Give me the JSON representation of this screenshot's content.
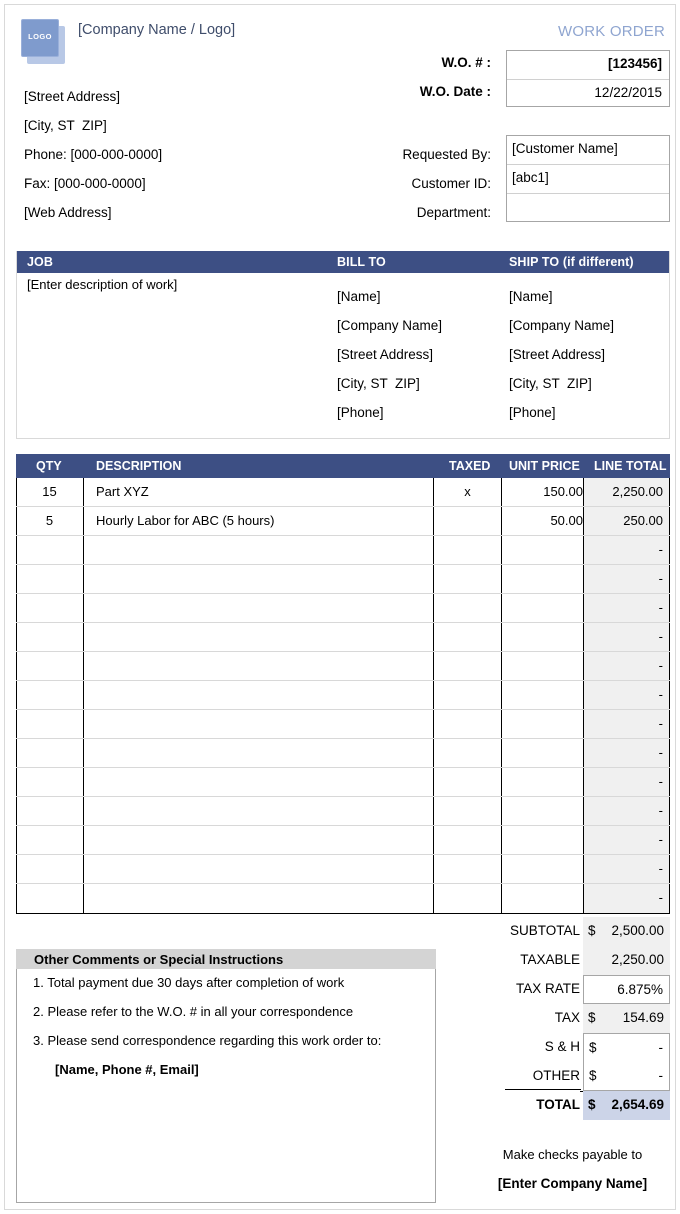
{
  "document": {
    "title": "WORK ORDER",
    "accent_color": "#3d4f84",
    "title_color": "#8fa5d0"
  },
  "company": {
    "logo_text": "LOGO",
    "name_placeholder": "[Company Name / Logo]",
    "address_lines": [
      "[Street Address]",
      "[City, ST  ZIP]",
      "Phone: [000-000-0000]",
      "Fax: [000-000-0000]",
      "[Web Address]"
    ]
  },
  "order_info": {
    "wo_number_label": "W.O. # :",
    "wo_number_value": "[123456]",
    "wo_date_label": "W.O. Date :",
    "wo_date_value": "12/22/2015",
    "requested_by_label": "Requested By:",
    "requested_by_value": "[Customer Name]",
    "customer_id_label": "Customer ID:",
    "customer_id_value": "[abc1]",
    "department_label": "Department:",
    "department_value": ""
  },
  "job_section": {
    "job_header": "JOB",
    "bill_to_header": "BILL TO",
    "ship_to_header": "SHIP TO (if different)",
    "job_description": "[Enter description of work]",
    "bill_to_lines": [
      "[Name]",
      "[Company Name]",
      "[Street Address]",
      "[City, ST  ZIP]",
      "[Phone]"
    ],
    "ship_to_lines": [
      "[Name]",
      "[Company Name]",
      "[Street Address]",
      "[City, ST  ZIP]",
      "[Phone]"
    ]
  },
  "line_items": {
    "columns": [
      "QTY",
      "DESCRIPTION",
      "TAXED",
      "UNIT PRICE",
      "LINE TOTAL"
    ],
    "rows": [
      {
        "qty": "15",
        "description": "Part XYZ",
        "taxed": "x",
        "unit_price": "150.00",
        "line_total": "2,250.00"
      },
      {
        "qty": "5",
        "description": "Hourly Labor for ABC (5 hours)",
        "taxed": "",
        "unit_price": "50.00",
        "line_total": "250.00"
      },
      {
        "qty": "",
        "description": "",
        "taxed": "",
        "unit_price": "",
        "line_total": "-"
      },
      {
        "qty": "",
        "description": "",
        "taxed": "",
        "unit_price": "",
        "line_total": "-"
      },
      {
        "qty": "",
        "description": "",
        "taxed": "",
        "unit_price": "",
        "line_total": "-"
      },
      {
        "qty": "",
        "description": "",
        "taxed": "",
        "unit_price": "",
        "line_total": "-"
      },
      {
        "qty": "",
        "description": "",
        "taxed": "",
        "unit_price": "",
        "line_total": "-"
      },
      {
        "qty": "",
        "description": "",
        "taxed": "",
        "unit_price": "",
        "line_total": "-"
      },
      {
        "qty": "",
        "description": "",
        "taxed": "",
        "unit_price": "",
        "line_total": "-"
      },
      {
        "qty": "",
        "description": "",
        "taxed": "",
        "unit_price": "",
        "line_total": "-"
      },
      {
        "qty": "",
        "description": "",
        "taxed": "",
        "unit_price": "",
        "line_total": "-"
      },
      {
        "qty": "",
        "description": "",
        "taxed": "",
        "unit_price": "",
        "line_total": "-"
      },
      {
        "qty": "",
        "description": "",
        "taxed": "",
        "unit_price": "",
        "line_total": "-"
      },
      {
        "qty": "",
        "description": "",
        "taxed": "",
        "unit_price": "",
        "line_total": "-"
      },
      {
        "qty": "",
        "description": "",
        "taxed": "",
        "unit_price": "",
        "line_total": "-"
      }
    ]
  },
  "comments": {
    "header": "Other Comments or Special Instructions",
    "lines": [
      "1. Total payment due 30 days after completion of work",
      "2. Please refer to the W.O. # in all your correspondence",
      "3. Please send correspondence regarding this work order to:"
    ],
    "contact_line": "[Name, Phone #, Email]"
  },
  "totals": {
    "rows": [
      {
        "label": "SUBTOTAL",
        "currency": "$",
        "value": "2,500.00"
      },
      {
        "label": "TAXABLE",
        "currency": "",
        "value": "2,250.00"
      },
      {
        "label": "TAX RATE",
        "currency": "",
        "value": "6.875%"
      },
      {
        "label": "TAX",
        "currency": "$",
        "value": "154.69"
      },
      {
        "label": "S & H",
        "currency": "$",
        "value": "-"
      },
      {
        "label": "OTHER",
        "currency": "$",
        "value": "-"
      },
      {
        "label": "TOTAL",
        "currency": "$",
        "value": "2,654.69"
      }
    ],
    "total_highlight_color": "#ccd4e8"
  },
  "payable": {
    "line1": "Make checks payable to",
    "line2": "[Enter Company Name]"
  }
}
